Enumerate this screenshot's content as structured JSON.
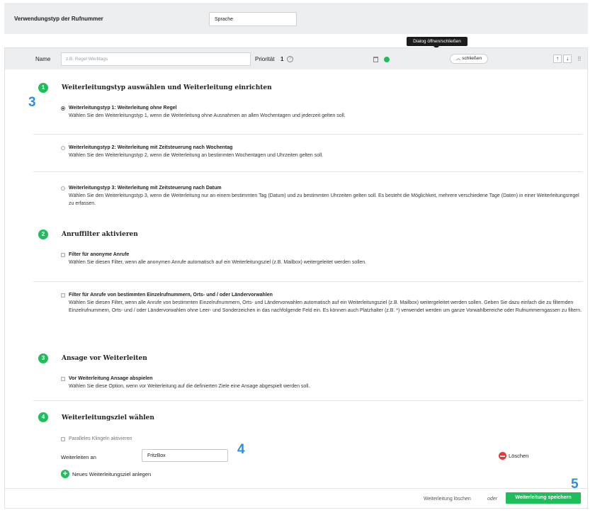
{
  "topbar": {
    "label": "Verwendungstyp der Rufnummer",
    "value": "Sprache"
  },
  "tooltip": "Dialog öffnen/schließen",
  "rule": {
    "name_label": "Name",
    "name_placeholder": "z.B. Regel Werktags",
    "priority_label": "Priorität",
    "priority_value": "1",
    "help_icon": "?",
    "close_label": "schließen",
    "close_chevron": "︿",
    "up_arrow": "↑",
    "down_arrow": "↓",
    "grip": "⠿",
    "status_color": "#1fbe5b"
  },
  "steps": [
    {
      "num": "1",
      "title": "Weiterleitungstyp auswählen und Weiterleitung einrichten",
      "options": [
        {
          "title": "Weiterleitungstyp 1: Weiterleitung ohne Regel",
          "desc": "Wählen Sie den Weiterleitungstyp 1, wenn die Weiterleitung ohne Ausnahmen an allen Wochentagen und jederzeit gelten soll.",
          "selected": true
        },
        {
          "title": "Weiterleitungstyp 2: Weiterleitung mit Zeitsteuerung nach Wochentag",
          "desc": "Wählen Sie den Weiterleitungstyp 2, wenn die Weiterleitung an bestimmten Wochentagen und Uhrzeiten gelten soll.",
          "selected": false
        },
        {
          "title": "Weiterleitungstyp 3: Weiterleitung mit Zeitsteuerung nach Datum",
          "desc": "Wählen Sie den Weiterleitungstyp 3, wenn die Weiterleitung nur an einem bestimmten Tag (Datum) und zu bestimmten Uhrzeiten gelten soll. Es besteht die Möglichkeit, mehrere verschiedene Tage (Daten) in einer Weiterleitungsregel zu erfassen.",
          "selected": false
        }
      ]
    },
    {
      "num": "2",
      "title": "Anruffilter aktivieren",
      "options": [
        {
          "title": "Filter für anonyme Anrufe",
          "desc": "Wählen Sie diesen Filter, wenn alle anonymen Anrufe automatisch auf ein Weiterleitungsziel (z.B. Mailbox) weitergeleitet werden sollen."
        },
        {
          "title": "Filter für Anrufe von bestimmten Einzelrufnummern, Orts- und / oder Ländervorwahlen",
          "desc": "Wählen Sie diesen Filter, wenn alle Anrufe von bestimmten Einzelrufnummern, Orts- und Ländervorwahlen automatisch auf ein Weiterleitungsziel (z.B. Mailbox) weitergeleitet werden sollen. Geben Sie dazu einfach die zu filternden Einzelrufnummern, Orts- und / oder Ländervorwahlen ohne Leer- und Sonderzeichen in das nachfolgende Feld ein. Es können auch Platzhalter (z.B. *) verwendet werden um ganze Vorwahlbereiche oder Rufnummerngassen zu filtern."
        }
      ]
    },
    {
      "num": "3",
      "title": "Ansage vor Weiterleiten",
      "options": [
        {
          "title": "Vor Weiterleitung Ansage abspielen",
          "desc": "Wählen Sie diese Option, wenn vor Weiterleitung auf die definierten Ziele eine Ansage abgespielt werden soll."
        }
      ]
    },
    {
      "num": "4",
      "title": "Weiterleitungsziel wählen",
      "parallel_label": "Paralleles Klingeln aktivieren",
      "forward_label": "Weiterleiten an",
      "forward_value": "FritzBox",
      "delete_label": "Löschen",
      "add_label": "Neues Weiterleitungsziel anlegen",
      "add_icon": "+"
    }
  ],
  "footer": {
    "delete_label": "Weiterleitung löschen",
    "or_label": "oder",
    "save_label": "Weiterleitung speichern"
  },
  "annotations": {
    "a3": "3",
    "a4": "4",
    "a5": "5",
    "color": "#2b8fe6"
  }
}
